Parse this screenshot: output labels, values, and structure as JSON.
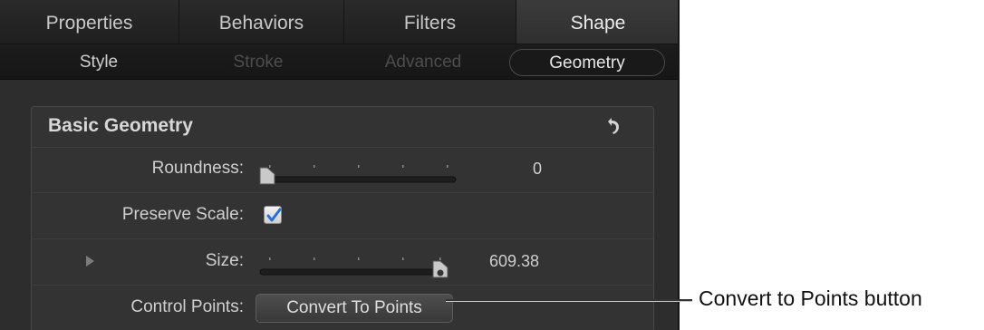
{
  "tabs": [
    {
      "label": "Properties",
      "active": false
    },
    {
      "label": "Behaviors",
      "active": false
    },
    {
      "label": "Filters",
      "active": false
    },
    {
      "label": "Shape",
      "active": true
    }
  ],
  "subtabs": [
    {
      "label": "Style",
      "state": "enabled"
    },
    {
      "label": "Stroke",
      "state": "disabled"
    },
    {
      "label": "Advanced",
      "state": "disabled"
    },
    {
      "label": "Geometry",
      "state": "active"
    }
  ],
  "group": {
    "title": "Basic Geometry",
    "reset_icon": "reset-arrow-icon",
    "roundness": {
      "label": "Roundness:",
      "value": "0",
      "slider_fraction": 0
    },
    "preserve_scale": {
      "label": "Preserve Scale:",
      "checked": true
    },
    "size": {
      "label": "Size:",
      "value": "609.38",
      "slider_fraction": 1
    },
    "control_points": {
      "label": "Control Points:",
      "button_label": "Convert To Points"
    }
  },
  "callout": {
    "text": "Convert to Points button"
  },
  "colors": {
    "panel_bg": "#2d2d2d",
    "checkbox_check": "#2a6fd6"
  }
}
